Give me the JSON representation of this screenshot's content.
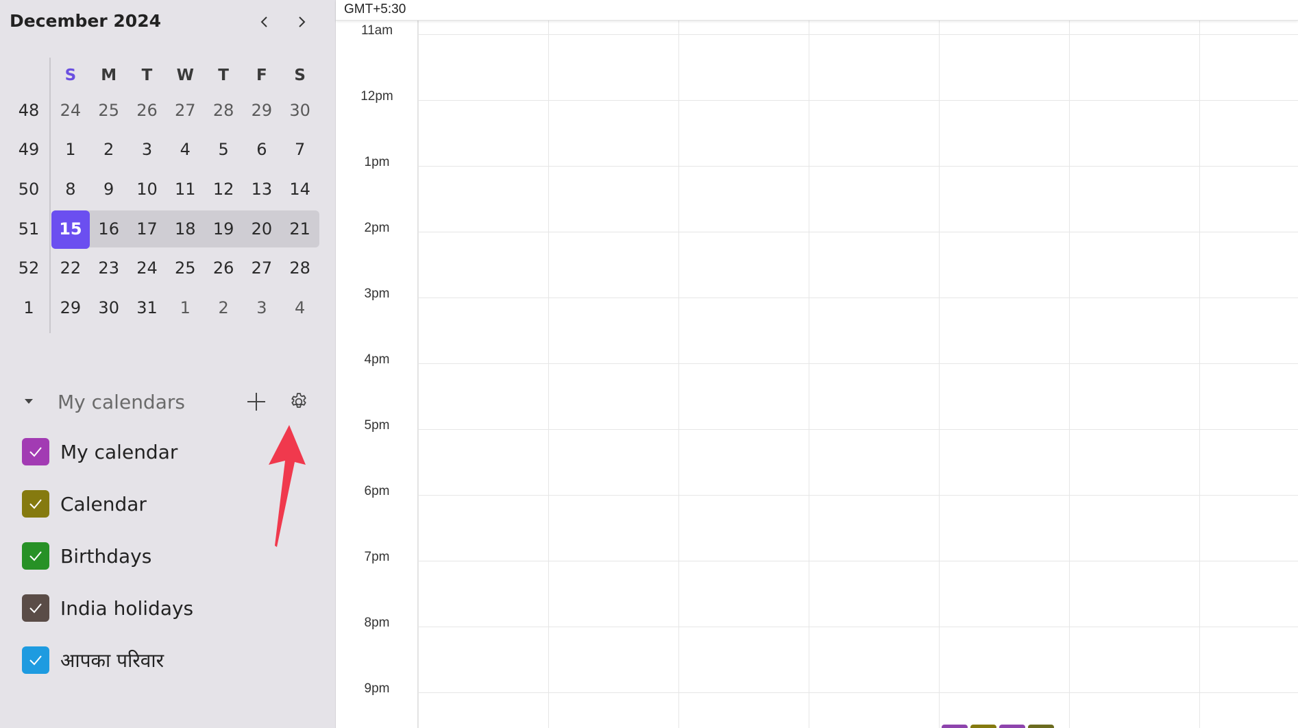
{
  "sidebar": {
    "month_title": "December 2024",
    "prev_icon": "chevron-left-icon",
    "next_icon": "chevron-right-icon",
    "days_of_week": [
      "S",
      "M",
      "T",
      "W",
      "T",
      "F",
      "S"
    ],
    "weeks": [
      {
        "num": "48",
        "days": [
          "24",
          "25",
          "26",
          "27",
          "28",
          "29",
          "30"
        ]
      },
      {
        "num": "49",
        "days": [
          "1",
          "2",
          "3",
          "4",
          "5",
          "6",
          "7"
        ]
      },
      {
        "num": "50",
        "days": [
          "8",
          "9",
          "10",
          "11",
          "12",
          "13",
          "14"
        ]
      },
      {
        "num": "51",
        "days": [
          "15",
          "16",
          "17",
          "18",
          "19",
          "20",
          "21"
        ]
      },
      {
        "num": "52",
        "days": [
          "22",
          "23",
          "24",
          "25",
          "26",
          "27",
          "28"
        ]
      },
      {
        "num": "1",
        "days": [
          "29",
          "30",
          "31",
          "1",
          "2",
          "3",
          "4"
        ]
      }
    ],
    "today": "15",
    "my_calendars": {
      "title": "My calendars",
      "add_icon": "plus-icon",
      "settings_icon": "gear-icon",
      "items": [
        {
          "label": "My calendar",
          "color": "#a23bb3"
        },
        {
          "label": "Calendar",
          "color": "#857a0f"
        },
        {
          "label": "Birthdays",
          "color": "#279126"
        },
        {
          "label": "India holidays",
          "color": "#5a4c47"
        },
        {
          "label": "आपका परिवार",
          "color": "#1e9be0"
        }
      ]
    }
  },
  "main": {
    "timezone": "GMT+5:30",
    "hours": [
      "11am",
      "12pm",
      "1pm",
      "2pm",
      "3pm",
      "4pm",
      "5pm",
      "6pm",
      "7pm",
      "8pm",
      "9pm"
    ]
  },
  "annotation": {
    "arrow_color": "#f0394d"
  },
  "event_colors": [
    "#8e44ad",
    "#857a0f",
    "#8e44ad",
    "#6b6b1f"
  ]
}
